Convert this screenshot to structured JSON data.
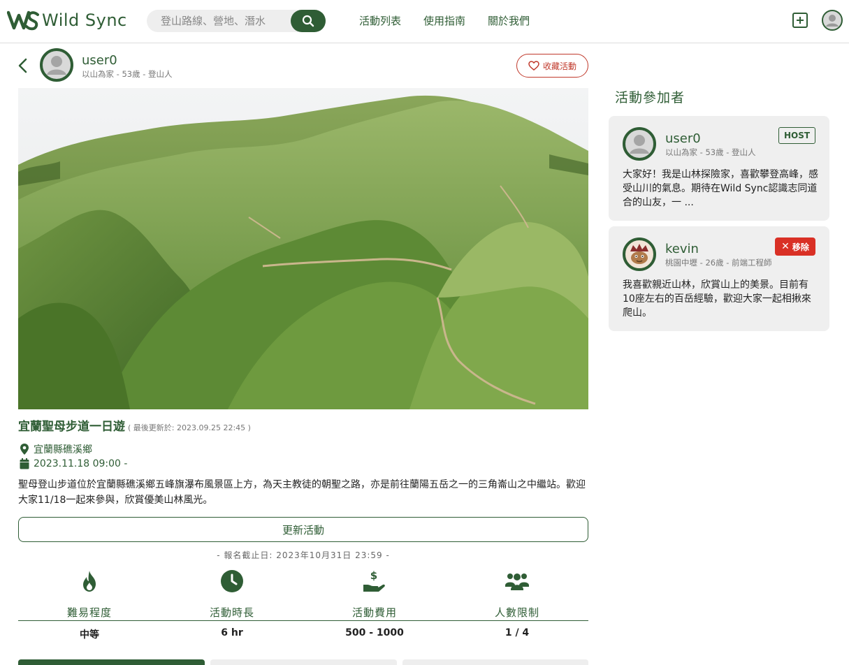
{
  "nav": {
    "brand": "Wild Sync",
    "search_placeholder": "登山路線、營地、潛水",
    "links": [
      "活動列表",
      "使用指南",
      "關於我們"
    ]
  },
  "host": {
    "name": "user0",
    "meta": "以山為家 - 53歲 - 登山人",
    "favorite_label": "收藏活動"
  },
  "event": {
    "title": "宜蘭聖母步道一日遊",
    "updated": "( 最後更新於: 2023.09.25 22:45 )",
    "location": "宜蘭縣礁溪鄉",
    "datetime": "2023.11.18 09:00 -",
    "description": "聖母登山步道位於宜蘭縣礁溪鄉五峰旗瀑布風景區上方，為天主教徒的朝聖之路，亦是前往蘭陽五岳之一的三角崙山之中繼站。歡迎大家11/18一起來參與，欣賞優美山林風光。",
    "update_button": "更新活動",
    "deadline": "- 報名截止日: 2023年10月31日 23:59 -",
    "stats": [
      {
        "label": "難易程度",
        "value": "中等",
        "icon": "flame-icon"
      },
      {
        "label": "活動時長",
        "value": "6 hr",
        "icon": "clock-icon"
      },
      {
        "label": "活動費用",
        "value": "500 - 1000",
        "icon": "money-hand-icon"
      },
      {
        "label": "人數限制",
        "value": "1 / 4",
        "icon": "users-icon"
      }
    ]
  },
  "participants": {
    "title": "活動參加者",
    "list": [
      {
        "name": "user0",
        "meta": "以山為家 - 53歲 - 登山人",
        "badge": "HOST",
        "bio": "大家好！我是山林探險家，喜歡攀登高峰，感受山川的氣息。期待在Wild Sync認識志同道合的山友，一 ..."
      },
      {
        "name": "kevin",
        "meta": "桃園中壢 - 26歲 - 前端工程師",
        "badge": "移除",
        "bio": "我喜歡親近山林，欣賞山上的美景。目前有10座左右的百岳經驗，歡迎大家一起相揪來爬山。"
      }
    ]
  },
  "colors": {
    "brand": "#2f5d35",
    "danger": "#d93025",
    "card_bg": "#efefef"
  }
}
